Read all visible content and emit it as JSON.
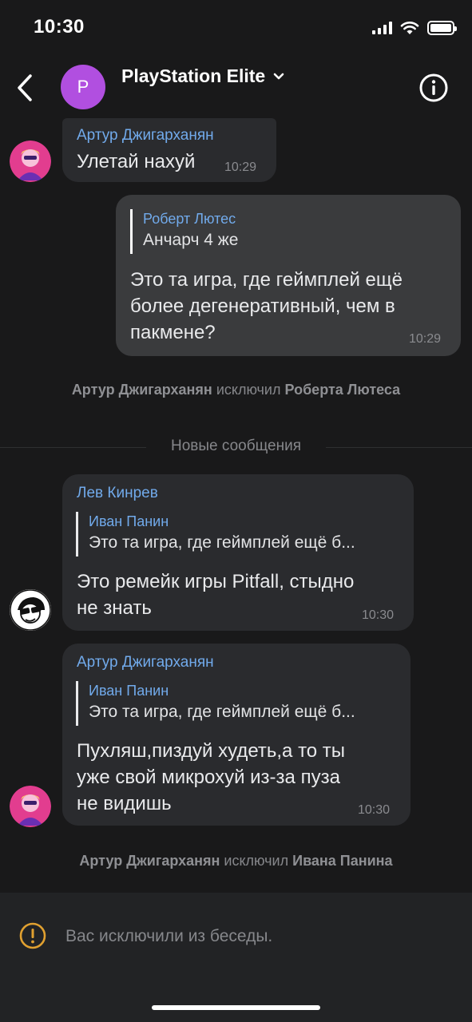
{
  "status_bar": {
    "time": "10:30"
  },
  "header": {
    "avatar_letter": "P",
    "title": "PlayStation Elite"
  },
  "messages": [
    {
      "sender": "Артур Джигарханян",
      "text": "Улетай нахуй",
      "time": "10:29",
      "avatar": "pink-avatar-icon"
    },
    {
      "outgoing": true,
      "reply": {
        "name": "Роберт Лютес",
        "text": "Анчарч 4 же"
      },
      "text_lines": [
        "Это та игра, где геймплей ещё",
        "более дегенеративный, чем в",
        "пакмене?"
      ],
      "time": "10:29"
    },
    {
      "sender": "Лев Кинрев",
      "reply": {
        "name": "Иван Панин",
        "text": "Это та игра, где геймплей ещё б..."
      },
      "text_lines": [
        "Это ремейк игры Pitfall, стыдно",
        "не знать"
      ],
      "time": "10:30",
      "avatar": "sunglasses-avatar-icon"
    },
    {
      "sender": "Артур Джигарханян",
      "reply": {
        "name": "Иван Панин",
        "text": "Это та игра, где геймплей ещё б..."
      },
      "text_lines": [
        "Пухляш,пиздуй худеть,а то ты",
        "уже свой микрохуй из-за пуза",
        "не видишь"
      ],
      "time": "10:30",
      "avatar": "pink-avatar-icon"
    }
  ],
  "service_1": {
    "actor": "Артур Джигарханян",
    "action": "исключил",
    "target": "Роберта Лютеса"
  },
  "new_messages_divider": "Новые сообщения",
  "service_2": {
    "actor": "Артур Джигарханян",
    "action": "исключил",
    "target": "Ивана Панина"
  },
  "footer": {
    "text": "Вас исключили из беседы."
  },
  "colors": {
    "background": "#19191a",
    "bubble_in": "#2a2b2e",
    "bubble_out": "#3a3b3d",
    "sender_name": "#71aaeb",
    "header_avatar": "#b14fe0",
    "warning": "#e0a030"
  }
}
